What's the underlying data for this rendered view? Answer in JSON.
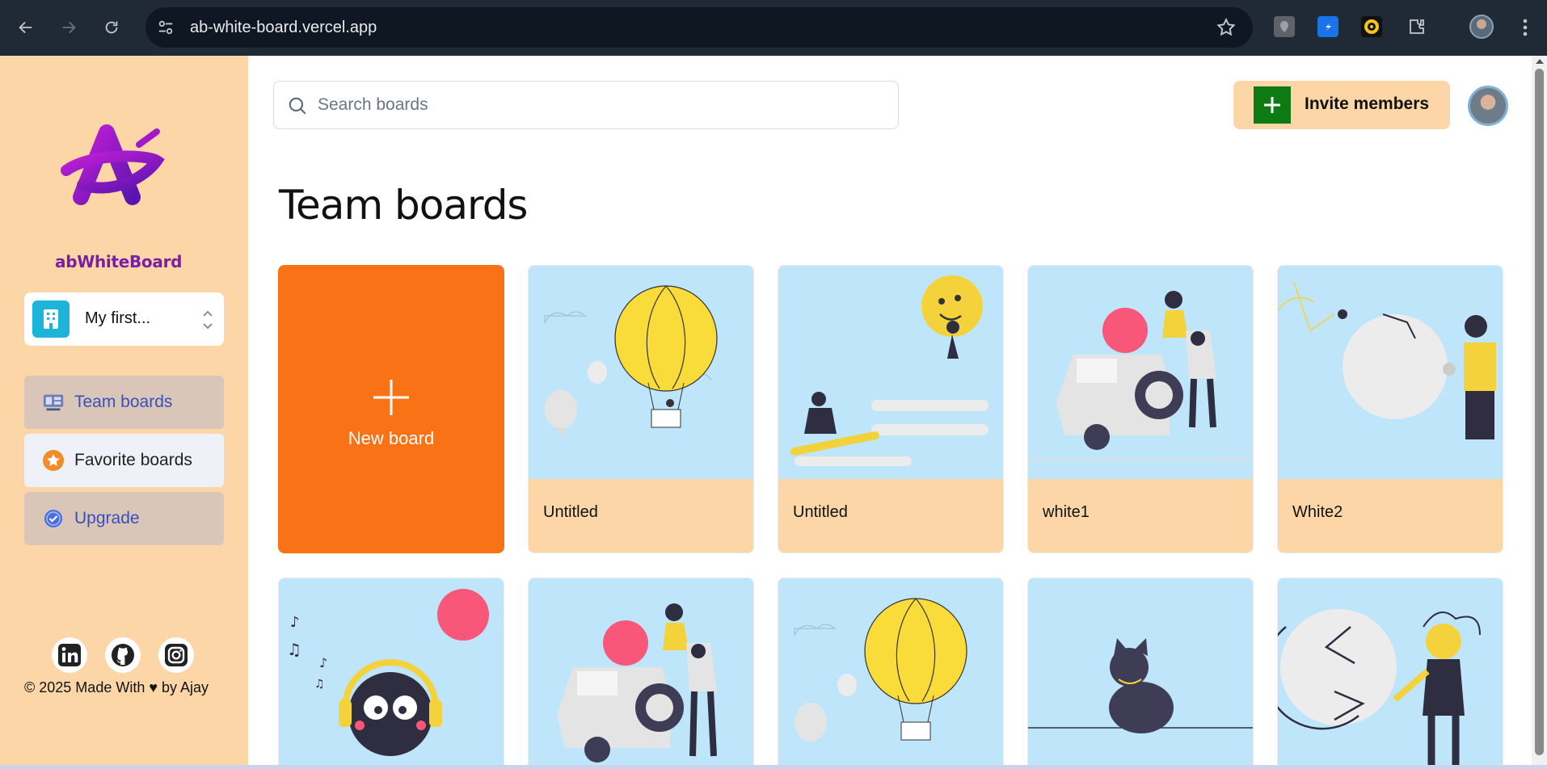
{
  "browser": {
    "url": "ab-white-board.vercel.app"
  },
  "sidebar": {
    "logo_text": "abWhiteBoard",
    "org_name": "My first...",
    "nav": {
      "team_boards": "Team boards",
      "favorite_boards": "Favorite boards",
      "upgrade": "Upgrade"
    },
    "footer": "© 2025 Made With ♥ by Ajay"
  },
  "header": {
    "search_placeholder": "Search boards",
    "invite_label": "Invite members"
  },
  "main": {
    "title": "Team boards",
    "new_board_label": "New board",
    "boards": [
      {
        "title": "Untitled",
        "art": "hot-air-balloon"
      },
      {
        "title": "Untitled",
        "art": "chat-smiley"
      },
      {
        "title": "white1",
        "art": "jeep-travelers"
      },
      {
        "title": "White2",
        "art": "moon-astronomy"
      }
    ],
    "boards_row2": [
      {
        "art": "bird-headphones"
      },
      {
        "art": "jeep-travelers"
      },
      {
        "art": "hot-air-balloon"
      },
      {
        "art": "black-cat"
      },
      {
        "art": "woman-circle-arrows"
      }
    ]
  },
  "colors": {
    "sidebar_bg": "#fdd6a7",
    "new_board_bg": "#f97316",
    "card_art_bg": "#bfe5fa",
    "invite_plus_bg": "#0e7a14",
    "nav_active_text": "#3a4fb8"
  }
}
